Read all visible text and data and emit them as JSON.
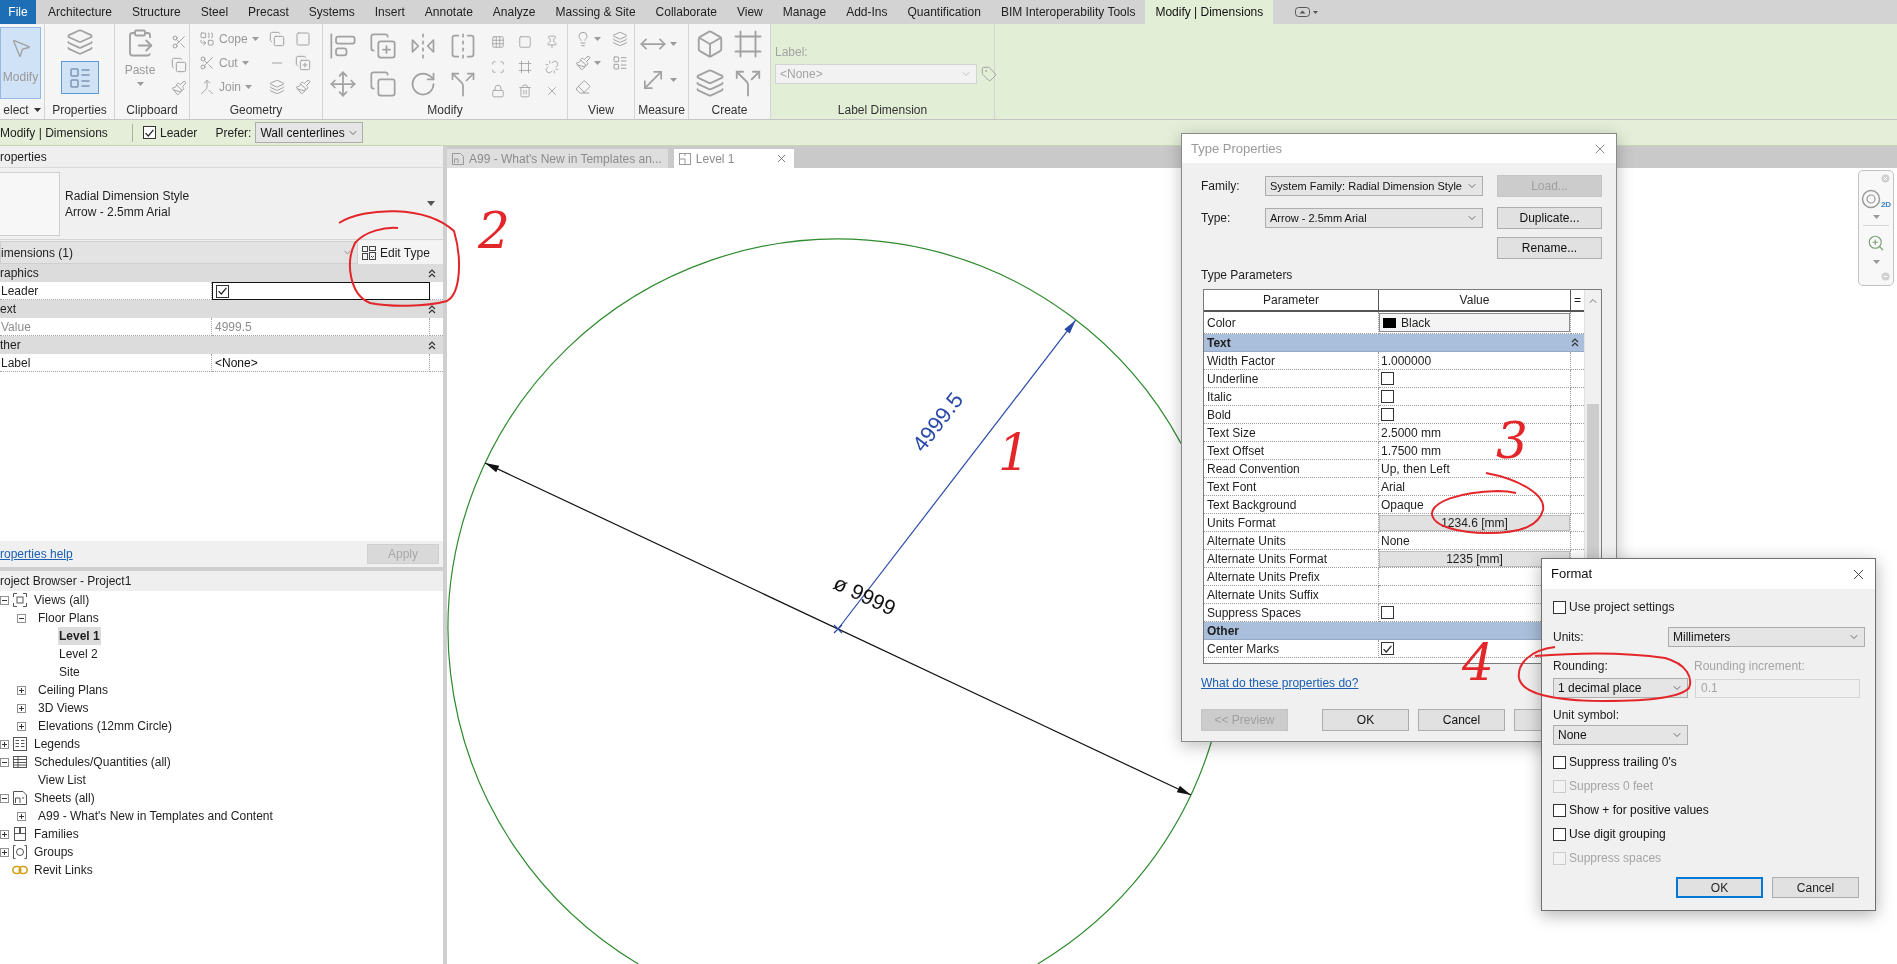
{
  "ribbon": {
    "file_tab": "File",
    "tabs": [
      {
        "label": "Architecture",
        "selected": false
      },
      {
        "label": "Structure",
        "selected": false
      },
      {
        "label": "Steel",
        "selected": false
      },
      {
        "label": "Precast",
        "selected": false
      },
      {
        "label": "Systems",
        "selected": false
      },
      {
        "label": "Insert",
        "selected": false
      },
      {
        "label": "Annotate",
        "selected": false
      },
      {
        "label": "Analyze",
        "selected": false
      },
      {
        "label": "Massing & Site",
        "selected": false
      },
      {
        "label": "Collaborate",
        "selected": false
      },
      {
        "label": "View",
        "selected": false
      },
      {
        "label": "Manage",
        "selected": false
      },
      {
        "label": "Add-Ins",
        "selected": false
      },
      {
        "label": "Quantification",
        "selected": false
      },
      {
        "label": "BIM Interoperability Tools",
        "selected": false
      },
      {
        "label": "Modify | Dimensions",
        "selected": true
      }
    ],
    "panels": [
      {
        "kind": "select",
        "label": "elect",
        "button": {
          "label": "Modify",
          "selected": true
        }
      },
      {
        "kind": "properties",
        "label": "Properties",
        "selected": true
      },
      {
        "kind": "clipboard",
        "label": "Clipboard",
        "paste": "Paste"
      },
      {
        "kind": "geometry",
        "label": "Geometry",
        "tools": [
          "Cope",
          "Cut",
          "Join"
        ]
      },
      {
        "kind": "modify",
        "label": "Modify"
      },
      {
        "kind": "view",
        "label": "View"
      },
      {
        "kind": "measure",
        "label": "Measure"
      },
      {
        "kind": "create",
        "label": "Create"
      },
      {
        "kind": "label",
        "label": "Label Dimension",
        "field_label": "Label:",
        "value": "<None>",
        "disabled": true
      }
    ]
  },
  "options_bar": {
    "context": "Modify | Dimensions",
    "leader": {
      "label": "Leader",
      "checked": true
    },
    "prefer": {
      "label": "Prefer:",
      "value": "Wall centerlines"
    }
  },
  "properties": {
    "title": "roperties",
    "type_family": "Radial Dimension Style",
    "type_name": "Arrow - 2.5mm Arial",
    "filter": "imensions (1)",
    "edit_type": "Edit Type",
    "groups": [
      {
        "name": "raphics",
        "expanded": true,
        "rows": [
          {
            "kind": "checkbox",
            "name": "Leader",
            "checked": true,
            "focused": true,
            "disabled": false
          }
        ]
      },
      {
        "name": "ext",
        "expanded": true,
        "rows": [
          {
            "kind": "text",
            "name": "Value",
            "value": "4999.5",
            "focused": false,
            "disabled": true
          }
        ]
      },
      {
        "name": "ther",
        "expanded": true,
        "rows": [
          {
            "kind": "text",
            "name": "Label",
            "value": "<None>",
            "focused": false,
            "disabled": false
          }
        ]
      }
    ],
    "help_link": "roperties help",
    "apply": {
      "label": "Apply",
      "disabled": true
    }
  },
  "project_browser": {
    "title": "roject Browser - Project1",
    "items": [
      {
        "kind": "views",
        "label": "Views (all)",
        "expanded": true,
        "selected": false,
        "children": [
          {
            "label": "Floor Plans",
            "expanded": true,
            "selected": false,
            "children": [
              {
                "label": "Level 1",
                "selected": true
              },
              {
                "label": "Level 2",
                "selected": false
              },
              {
                "label": "Site",
                "selected": false
              }
            ]
          },
          {
            "label": "Ceiling Plans",
            "expanded": false,
            "selected": false
          },
          {
            "label": "3D Views",
            "expanded": false,
            "selected": false
          },
          {
            "label": "Elevations (12mm Circle)",
            "expanded": false,
            "selected": false
          }
        ]
      },
      {
        "kind": "legends",
        "label": "Legends",
        "expanded": false,
        "selected": false
      },
      {
        "kind": "schedules",
        "label": "Schedules/Quantities (all)",
        "expanded": true,
        "selected": false,
        "children": [
          {
            "label": "View List",
            "selected": false
          }
        ]
      },
      {
        "kind": "sheets",
        "label": "Sheets (all)",
        "expanded": true,
        "selected": false,
        "children": [
          {
            "label": "A99 - What's New in Templates and Content",
            "expanded": false,
            "selected": false
          }
        ]
      },
      {
        "kind": "families",
        "label": "Families",
        "expanded": false,
        "selected": false
      },
      {
        "kind": "groups",
        "label": "Groups",
        "expanded": false,
        "selected": false
      },
      {
        "kind": "links",
        "label": "Revit Links",
        "selected": false
      }
    ]
  },
  "view_tabs": [
    {
      "kind": "sheet",
      "label": "A99 - What's New in Templates an...",
      "selected": false
    },
    {
      "kind": "plan",
      "label": "Level 1",
      "selected": true
    }
  ],
  "canvas": {
    "diameter_text": "ø 9999",
    "radius_text": "4999.5"
  },
  "navigation_bar": {
    "wheel_label": "2D"
  },
  "type_properties": {
    "title": "Type Properties",
    "family": {
      "label": "Family:",
      "value": "System Family: Radial Dimension Style"
    },
    "type": {
      "label": "Type:",
      "value": "Arrow - 2.5mm Arial"
    },
    "side_buttons": [
      {
        "label": "Load...",
        "disabled": true
      },
      {
        "label": "Duplicate...",
        "disabled": false
      },
      {
        "label": "Rename...",
        "disabled": false
      }
    ],
    "section_label": "Type Parameters",
    "columns": [
      "Parameter",
      "Value",
      "="
    ],
    "parameters": [
      {
        "kind": "swatch",
        "name": "Color",
        "value": "Black",
        "color": "#000000"
      },
      {
        "kind": "group",
        "name": "Text",
        "expanded": true
      },
      {
        "kind": "text",
        "name": "Width Factor",
        "value": "1.000000"
      },
      {
        "kind": "checkbox",
        "name": "Underline",
        "checked": false
      },
      {
        "kind": "checkbox",
        "name": "Italic",
        "checked": false
      },
      {
        "kind": "checkbox",
        "name": "Bold",
        "checked": false
      },
      {
        "kind": "text",
        "name": "Text Size",
        "value": "2.5000 mm"
      },
      {
        "kind": "text",
        "name": "Text Offset",
        "value": "1.7500 mm"
      },
      {
        "kind": "text",
        "name": "Read Convention",
        "value": "Up, then Left"
      },
      {
        "kind": "text",
        "name": "Text Font",
        "value": "Arial"
      },
      {
        "kind": "text",
        "name": "Text Background",
        "value": "Opaque"
      },
      {
        "kind": "button",
        "name": "Units Format",
        "value": "1234.6 [mm]"
      },
      {
        "kind": "text",
        "name": "Alternate Units",
        "value": "None"
      },
      {
        "kind": "button",
        "name": "Alternate Units Format",
        "value": "1235 [mm]"
      },
      {
        "kind": "text",
        "name": "Alternate Units Prefix"
      },
      {
        "kind": "text",
        "name": "Alternate Units Suffix"
      },
      {
        "kind": "checkbox",
        "name": "Suppress Spaces",
        "checked": false
      },
      {
        "kind": "group",
        "name": "Other"
      },
      {
        "kind": "checkbox",
        "name": "Center Marks",
        "checked": true
      }
    ],
    "help_link": "What do these properties do?",
    "buttons": [
      {
        "label": "<< Preview",
        "disabled": true
      },
      {
        "label": "OK",
        "disabled": false
      },
      {
        "label": "Cancel",
        "disabled": false
      }
    ]
  },
  "format_dialog": {
    "title": "Format",
    "use_project_settings": {
      "label": "Use project settings",
      "checked": false
    },
    "units_label": "Units:",
    "units_value": "Millimeters",
    "rounding_label": "Rounding:",
    "rounding_value": "1 decimal place",
    "increment": {
      "label": "Rounding increment:",
      "value": "0.1",
      "disabled": true
    },
    "unit_symbol_label": "Unit symbol:",
    "unit_symbol_value": "None",
    "options": [
      {
        "label": "Suppress trailing 0's",
        "checked": false,
        "disabled": false
      },
      {
        "label": "Suppress 0 feet",
        "checked": false,
        "disabled": true
      },
      {
        "label": "Show + for positive values",
        "checked": false,
        "disabled": false
      },
      {
        "label": "Use digit grouping",
        "checked": false,
        "disabled": false
      },
      {
        "label": "Suppress spaces",
        "checked": false,
        "disabled": true
      }
    ],
    "buttons": [
      {
        "label": "OK",
        "default": true
      },
      {
        "label": "Cancel",
        "default": false
      }
    ]
  },
  "annotations": [
    {
      "text": "1"
    },
    {
      "text": "2"
    },
    {
      "text": "3"
    },
    {
      "text": "4"
    }
  ]
}
